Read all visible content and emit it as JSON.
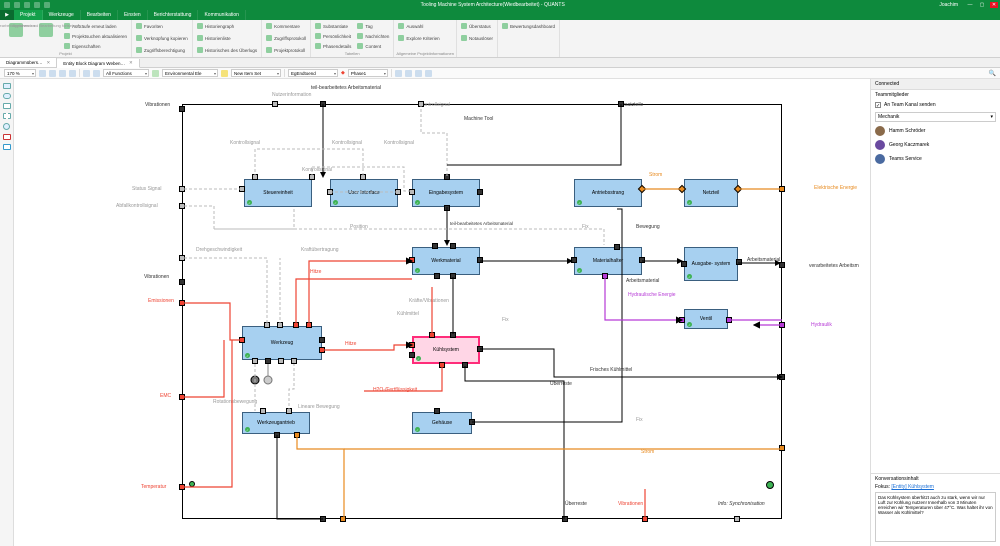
{
  "titlebar": {
    "title": "Tooling Machine System Architecture(Wiedbearbeitet) - QUANTS",
    "user_label": "Joachim",
    "min": "—",
    "max": "▢",
    "close": "✕"
  },
  "menu": {
    "go_icon": "▶",
    "tabs": [
      "Projekt",
      "Werkzeuge",
      "Bearbeiten",
      "Einsten",
      "Berichterstattung",
      "Kommunikation"
    ],
    "active_index": 0
  },
  "ribbon": {
    "groups": [
      {
        "label": "Projekt",
        "big": [
          "Bearbeitung beenden",
          "Speichern und Bearbeitung fortsetzen"
        ],
        "small": [
          "Aufträufe erneut laden",
          "Projektsuchen aktualisieren",
          "Eigenschaften"
        ]
      },
      {
        "label": "",
        "small": [
          "Favoriten",
          "Verknüpfung kopieren",
          "Zugriffsberechtigung"
        ]
      },
      {
        "label": "",
        "small": [
          "Historiengraph",
          "Historienliste",
          "Historisches des Überlugs"
        ]
      },
      {
        "label": "",
        "small": [
          "Kommentare",
          "Zugriffsprotokoll",
          "Projektprotokoll"
        ]
      },
      {
        "label": "Tabellen",
        "small": [
          "Substantiate",
          "Persönlichkeit",
          "Phasendetails",
          "Tag",
          "Nachrichten",
          "Content"
        ]
      },
      {
        "label": "Allgemeine Projektinformationen",
        "small": [
          "Auswahl",
          "Explore Kriterien",
          ""
        ]
      },
      {
        "label": "",
        "small": [
          "Überstatus",
          "Notauslöser"
        ]
      },
      {
        "label": "",
        "small": [
          "Bewertungsdashboard"
        ]
      }
    ]
  },
  "doctabs": {
    "tabs": [
      {
        "label": "Diagrammübers…",
        "active": false
      },
      {
        "label": "Entity Block Diagram Weben…",
        "active": true
      }
    ]
  },
  "toolbar": {
    "zoom": "170 %",
    "functions_label": "All Functions",
    "env_label": "Environmental Ele",
    "set_label": "New Item Set",
    "endtoend_label": "EgEndtoend",
    "phase_label": "Phase1"
  },
  "side": {
    "connected_title": "Connected",
    "group_title": "Teammitglieder",
    "checkbox_label": "An Team Kanal senden",
    "combo_value": "Mechanik",
    "users": [
      "Hamm Schröder",
      "Georg Kaczmarek",
      "Teams Service"
    ],
    "conv_title": "Konversationsinhalt",
    "focus_label": "Fokus:",
    "focus_link": "[Entity] Kühlsystem",
    "textarea": "Das Kühlsystem überhitzt auch zu stark, wenn wir nur Luft zur Kühlung nutzen! Innerhalb von 3 Minuten erreichen wir Temperaturen über 47°C. Was haltet ihr von Wasser als Kühlmittel?"
  },
  "diagram": {
    "title_label": "teil-bearbeitetes Arbeitsmaterial",
    "labels": {
      "nutzerinfo": "Nutzerinformation",
      "vibr": "Vibrationen",
      "kontrollsig": "Kontrollsignal",
      "machinetool": "Machine Tool",
      "ersatzteile": "Ersatzteile",
      "statusignal": "Status Signal",
      "abfallkontroll": "Abfallkontrollsignal",
      "position": "Position",
      "drehgeschw": "Drehgeschwindigkeit",
      "kraftuebertragung": "Kraftübertragung",
      "hitze": "Hitze",
      "kraftvibr": "Kräfte/Vibrationen",
      "kuehlmittel": "Kühlmittel",
      "teilbearbeitet": "teil-bearbeitetes Arbeitsmaterial",
      "fix": "Fix",
      "bewegung": "Bewegung",
      "strom": "Strom",
      "elenergie": "Elektrische Energie",
      "arbeitsmaterial": "Arbeitsmaterial",
      "verarb": "verarbeitetes Arbeitsm",
      "hydene": "Hydraulische Energie",
      "hydraulik": "Hydraulik",
      "frischeskuehl": "Frisches Kühlmittel",
      "ueberreste": "Überreste",
      "emissionen": "Emissionen",
      "emc": "EMC",
      "rotation": "Rotationsbewegung",
      "lineare": "Lineare Bewegung",
      "temperatur": "Temperatur",
      "infosync": "Info: Synchronisation",
      "h2ofert": "H2O-/Fertflüssigkeit"
    },
    "blocks": {
      "steuereinheit": "Steuereinheit",
      "ui": "User Interface",
      "eingabe": "Eingabesystem",
      "antrieb": "Antriebsstrang",
      "netzteil": "Netzteil",
      "werkmaterial": "Werkmaterial",
      "materialhalter": "Materialhalter",
      "ausgabe": "Ausgabe-\nsystem",
      "werkzeug": "Werkzeug",
      "kuehlsystem": "Kühlsystem",
      "ventil": "Ventil",
      "werkzeugantrieb": "Werkzeugantrieb",
      "gehaeuse": "Gehäuse"
    }
  }
}
